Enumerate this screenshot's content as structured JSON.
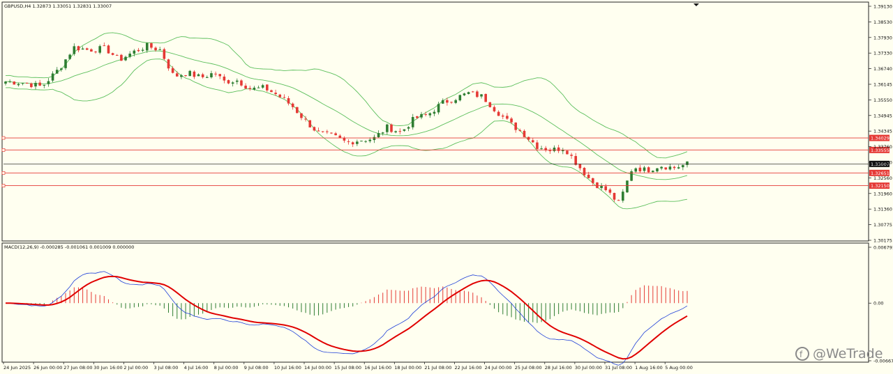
{
  "header": {
    "symbol_line": "GBPUSD,H4  1.32873 1.33051 1.32831 1.33007"
  },
  "macd_header": "MACD(12,26,9) -0.000285 -0.001061 0.001009 0.000000",
  "watermark": "@WeTrade",
  "colors": {
    "background": "#fffff0",
    "bull": "#2e7d32",
    "bear": "#e53935",
    "band": "#5cbf5c",
    "level": "#e53935",
    "price_line": "#111111",
    "macd_line": "#1e3fd8",
    "signal_line": "#e00000"
  },
  "chart_data": [
    {
      "type": "candlestick",
      "title": "GBPUSD,H4",
      "ylim": [
        1.3,
        1.3935
      ],
      "y_ticks": [
        "1.39130",
        "1.38530",
        "1.37930",
        "1.37330",
        "1.36740",
        "1.36145",
        "1.35550",
        "1.34945",
        "1.34345",
        "1.33760",
        "1.33160",
        "1.32560",
        "1.31960",
        "1.31360",
        "1.30775",
        "1.30175"
      ],
      "x_ticks": [
        "24 Jun 2025",
        "26 Jun 00:00",
        "27 Jun 08:00",
        "30 Jun 16:00",
        "2 Jul 00:00",
        "3 Jul 08:00",
        "4 Jul 16:00",
        "8 Jul 00:00",
        "9 Jul 08:00",
        "10 Jul 16:00",
        "14 Jul 00:00",
        "15 Jul 08:00",
        "16 Jul 16:00",
        "18 Jul 00:00",
        "21 Jul 08:00",
        "22 Jul 16:00",
        "24 Jul 00:00",
        "25 Jul 08:00",
        "28 Jul 16:00",
        "30 Jul 00:00",
        "31 Jul 08:00",
        "1 Aug 16:00",
        "5 Aug 00:00"
      ],
      "current_price": {
        "value": 1.33007,
        "label": "1.33007"
      },
      "levels": [
        {
          "value": 1.34029,
          "label": "1.34029"
        },
        {
          "value": 1.33555,
          "label": "1.33555"
        },
        {
          "value": 1.32651,
          "label": "1.32651"
        },
        {
          "value": 1.3215,
          "label": "1.32150"
        }
      ],
      "close_path": [
        [
          0,
          1.3625
        ],
        [
          4,
          1.362
        ],
        [
          8,
          1.3605
        ],
        [
          12,
          1.368
        ],
        [
          15,
          1.376
        ],
        [
          18,
          1.375
        ],
        [
          22,
          1.3755
        ],
        [
          25,
          1.371
        ],
        [
          28,
          1.374
        ],
        [
          31,
          1.3765
        ],
        [
          34,
          1.375
        ],
        [
          37,
          1.3645
        ],
        [
          40,
          1.366
        ],
        [
          43,
          1.364
        ],
        [
          46,
          1.366
        ],
        [
          48,
          1.3625
        ],
        [
          51,
          1.363
        ],
        [
          54,
          1.3595
        ],
        [
          57,
          1.36
        ],
        [
          60,
          1.357
        ],
        [
          63,
          1.353
        ],
        [
          66,
          1.347
        ],
        [
          69,
          1.342
        ],
        [
          72,
          1.341
        ],
        [
          75,
          1.3385
        ],
        [
          78,
          1.3395
        ],
        [
          81,
          1.34
        ],
        [
          84,
          1.3445
        ],
        [
          87,
          1.3425
        ],
        [
          90,
          1.348
        ],
        [
          93,
          1.3495
        ],
        [
          96,
          1.354
        ],
        [
          99,
          1.356
        ],
        [
          102,
          1.358
        ],
        [
          105,
          1.3565
        ],
        [
          108,
          1.351
        ],
        [
          111,
          1.346
        ],
        [
          114,
          1.342
        ],
        [
          117,
          1.337
        ],
        [
          120,
          1.3355
        ],
        [
          123,
          1.3365
        ],
        [
          126,
          1.3295
        ],
        [
          129,
          1.323
        ],
        [
          132,
          1.32
        ],
        [
          135,
          1.3145
        ],
        [
          138,
          1.329
        ],
        [
          141,
          1.3275
        ],
        [
          144,
          1.3295
        ],
        [
          147,
          1.3285
        ],
        [
          150,
          1.33
        ]
      ],
      "candles_count": 160,
      "series": [
        {
          "kind": "bollinger",
          "period": 20,
          "deviations": 2
        }
      ]
    },
    {
      "type": "macd",
      "title": "MACD(12,26,9)",
      "values": {
        "main": -0.000285,
        "signal": -0.001061,
        "histogram": 0.001009
      },
      "ylim": [
        -0.006674,
        0.006791
      ],
      "y_ticks": [
        "0.006791",
        "0.00",
        "-0.006674"
      ],
      "series": [
        {
          "kind": "macd_line"
        },
        {
          "kind": "signal_line"
        },
        {
          "kind": "histogram"
        }
      ]
    }
  ]
}
